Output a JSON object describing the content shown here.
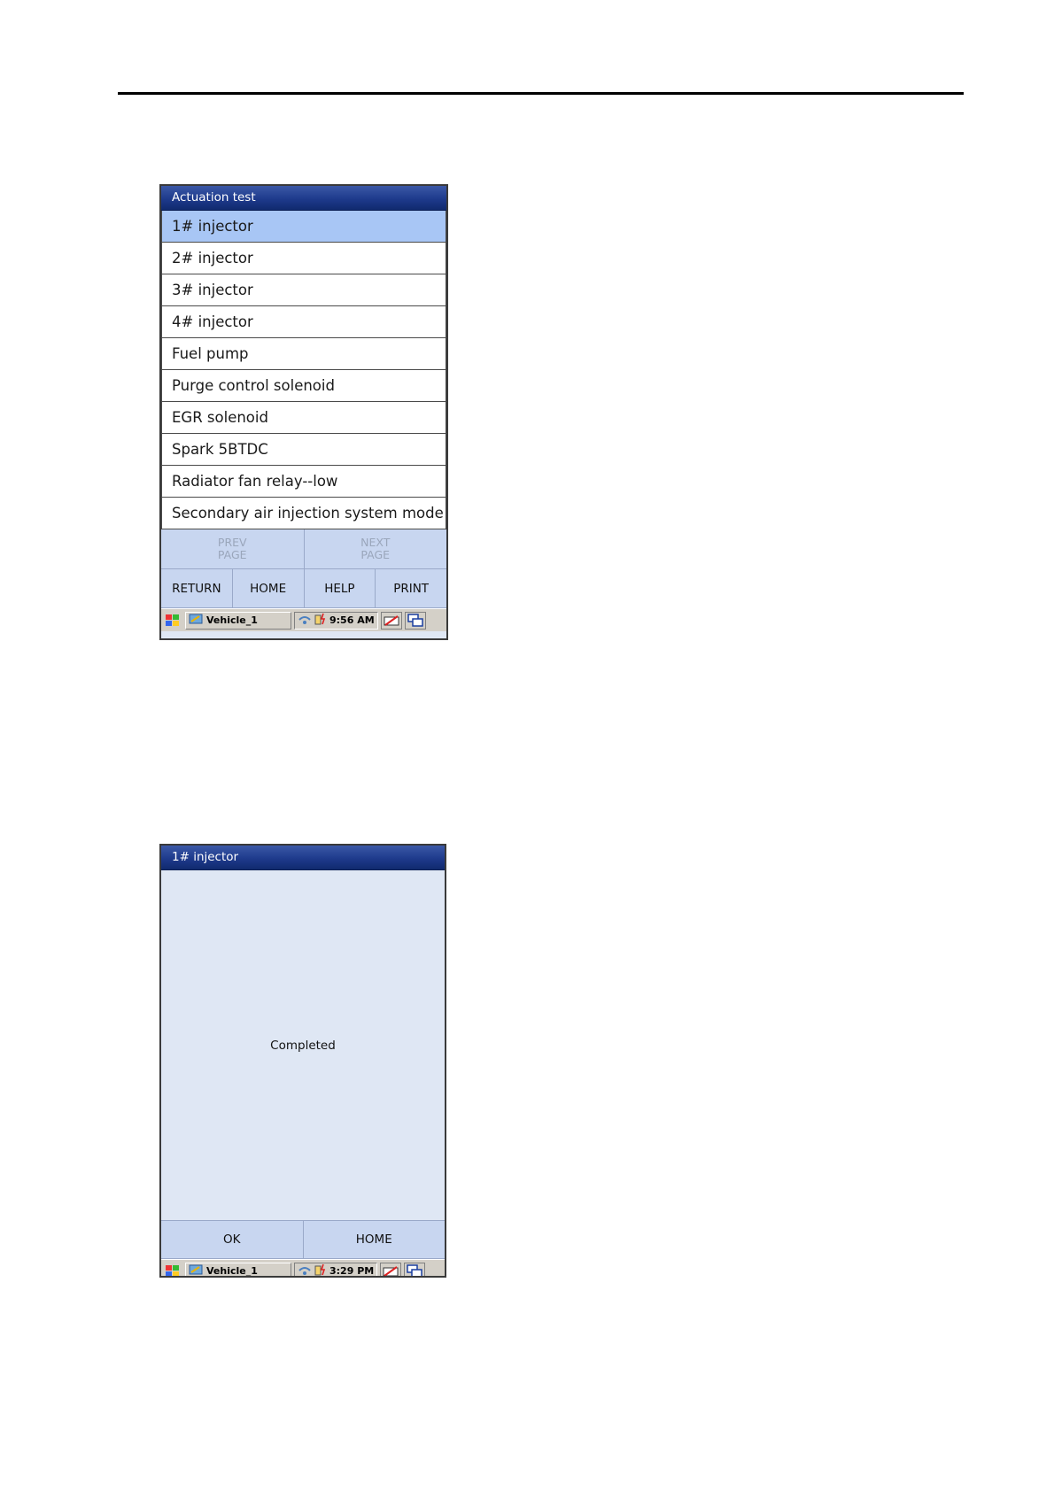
{
  "screen1": {
    "title": "Actuation test",
    "items": [
      "1# injector",
      "2# injector",
      "3# injector",
      "4# injector",
      "Fuel pump",
      "Purge control solenoid",
      "EGR solenoid",
      "Spark 5BTDC",
      "Radiator fan relay--low",
      "Secondary air injection system mode"
    ],
    "prev_page": [
      "PREV",
      "PAGE"
    ],
    "next_page": [
      "NEXT",
      "PAGE"
    ],
    "return_label": "RETURN",
    "home_label": "HOME",
    "help_label": "HELP",
    "print_label": "PRINT",
    "taskbar": {
      "task": "Vehicle_1",
      "time": "9:56 AM"
    }
  },
  "screen2": {
    "title": "1# injector",
    "message": "Completed",
    "ok_label": "OK",
    "home_label": "HOME",
    "taskbar": {
      "task": "Vehicle_1",
      "time": "3:29 PM"
    }
  }
}
